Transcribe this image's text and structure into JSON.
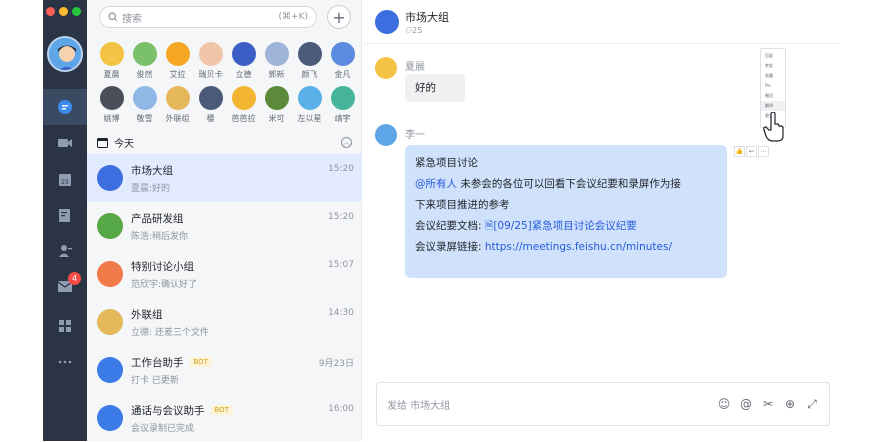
{
  "search": {
    "placeholder": "搜索",
    "shortcut": "(⌘+K)"
  },
  "contacts": [
    {
      "name": "夏晨",
      "color": "#f3c343"
    },
    {
      "name": "俊然",
      "color": "#7bc06b"
    },
    {
      "name": "艾拉",
      "color": "#f5a623"
    },
    {
      "name": "瑞贝卡",
      "color": "#f0c5a8"
    },
    {
      "name": "立德",
      "color": "#3b5fc4"
    },
    {
      "name": "郭新",
      "color": "#9eb4d9"
    },
    {
      "name": "颜飞",
      "color": "#4a5a78"
    },
    {
      "name": "金凡",
      "color": "#5b8be0"
    },
    {
      "name": "姚博",
      "color": "#4a4f5a"
    },
    {
      "name": "敬雪",
      "color": "#8fb8e6"
    },
    {
      "name": "外联组",
      "color": "#e6b85c"
    },
    {
      "name": "樱",
      "color": "#4a5a78"
    },
    {
      "name": "芭芭拉",
      "color": "#f2b632"
    },
    {
      "name": "米可",
      "color": "#5a8a3a"
    },
    {
      "name": "左以星",
      "color": "#5ab0e8"
    },
    {
      "name": "靖宇",
      "color": "#46b49a"
    }
  ],
  "section": {
    "today": "今天"
  },
  "chats": [
    {
      "title": "市场大组",
      "sub": "夏晨:好的",
      "time": "15:20",
      "color": "#3b6fe0",
      "bot": ""
    },
    {
      "title": "产品研发组",
      "sub": "陈浩:稍后发你",
      "time": "15:20",
      "color": "#56a846",
      "bot": ""
    },
    {
      "title": "特别讨论小组",
      "sub": "范欣宇:确认好了",
      "time": "15:07",
      "color": "#f07a4a",
      "bot": ""
    },
    {
      "title": "外联组",
      "sub": "立德: 还差三个文件",
      "time": "14:30",
      "color": "#e6b85c",
      "bot": ""
    },
    {
      "title": "工作台助手",
      "sub": "打卡 已更新",
      "time": "9月23日",
      "color": "#3b7be8",
      "bot": "BOT"
    },
    {
      "title": "通话与会议助手",
      "sub": "会议录制已完成",
      "time": "16:00",
      "color": "#3b7be8",
      "bot": "BOT"
    }
  ],
  "rail": {
    "badge": "4"
  },
  "header": {
    "title": "市场大组",
    "count": "25"
  },
  "messages": {
    "m1": {
      "sender": "夏晨",
      "text": "好的"
    },
    "m2": {
      "sender": "李一",
      "line1": "紧急项目讨论",
      "mention": "@所有人",
      "line2a": " 未参会的各位可以回看下会议纪要和录屏作为接",
      "line2b": "下来项目推进的参考",
      "doc_label": "会议纪要文档: ",
      "doc_link": "[09/25]紧急项目讨论会议纪要",
      "rec_label": "会议录屏链接: ",
      "rec_link": "https://meetings.feishu.cn/minutes/"
    }
  },
  "context_menu": [
    "回复",
    "转发",
    "收藏",
    "Pin",
    "撤回",
    "翻译",
    "更多"
  ],
  "composer": {
    "placeholder": "发给 市场大组"
  }
}
